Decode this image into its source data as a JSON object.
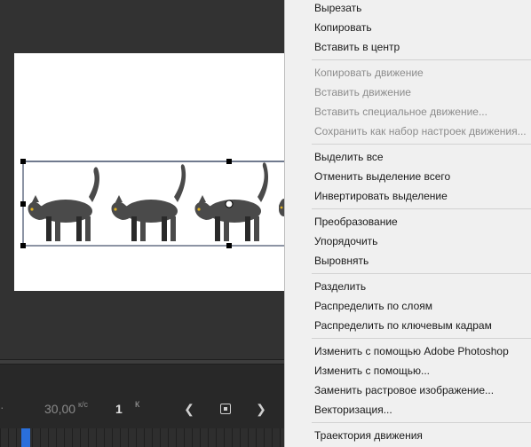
{
  "timeline": {
    "fps_value": "30,00",
    "fps_unit": "к/с",
    "frame_value": "1",
    "frame_unit": "К",
    "prev_icon": "chevron-left",
    "loop_icon": "loop-toggle",
    "next_icon": "chevron-right",
    "playhead_color": "#2a6fdb"
  },
  "colors": {
    "workspace_bg": "#323232",
    "stage_bg": "#ffffff",
    "cat_body": "#4a4a4a",
    "cat_eye": "#e0b020",
    "selection_line": "#000000",
    "menu_bg": "#f0f0f0"
  },
  "context_menu": {
    "group1": {
      "cut": "Вырезать",
      "copy": "Копировать",
      "paste_center": "Вставить в центр"
    },
    "group2": {
      "copy_motion": "Копировать движение",
      "paste_motion": "Вставить движение",
      "paste_special_motion": "Вставить специальное движение...",
      "save_motion_preset": "Сохранить как набор настроек движения..."
    },
    "group3": {
      "select_all": "Выделить все",
      "deselect_all": "Отменить выделение всего",
      "invert_selection": "Инвертировать выделение"
    },
    "group4": {
      "transform": "Преобразование",
      "arrange": "Упорядочить",
      "align": "Выровнять"
    },
    "group5": {
      "break_apart": "Разделить",
      "distribute_layers": "Распределить по слоям",
      "distribute_keyframes": "Распределить по ключевым кадрам"
    },
    "group6": {
      "edit_photoshop": "Изменить с помощью Adobe Photoshop",
      "edit_with": "Изменить с помощью...",
      "swap_bitmap": "Заменить растровое изображение...",
      "trace_bitmap": "Векторизация..."
    },
    "group7": {
      "motion_path": "Траектория движения"
    }
  }
}
